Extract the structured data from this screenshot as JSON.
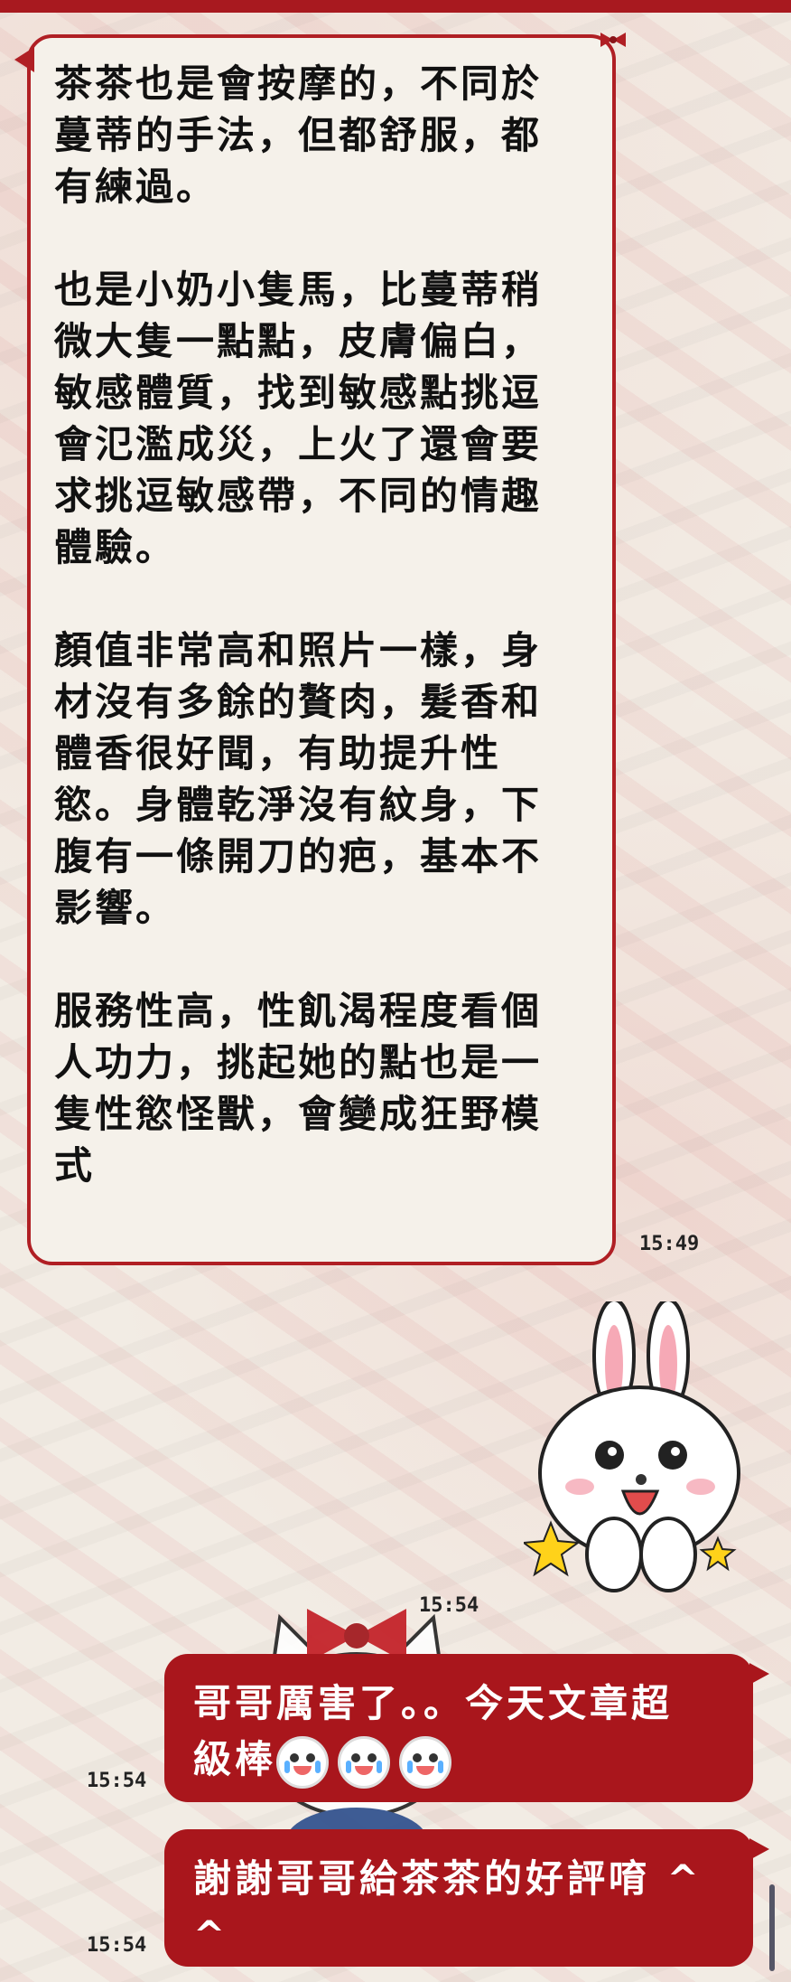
{
  "colors": {
    "accent": "#a9161c",
    "incoming_bubble_bg": "#f5f1ea",
    "incoming_bubble_border": "#b01f24"
  },
  "incoming": {
    "text": "茶茶也是會按摩的，不同於\n蔓蒂的手法，但都舒服，都\n有練過。\n\n也是小奶小隻馬，比蔓蒂稍\n微大隻一點點，皮膚偏白，\n敏感體質，找到敏感點挑逗\n會氾濫成災，上火了還會要\n求挑逗敏感帶，不同的情趣\n體驗。\n\n顏值非常高和照片一樣，身\n材沒有多餘的贅肉，髮香和\n體香很好聞，有助提升性\n慾。身體乾淨沒有紋身，下\n腹有一條開刀的疤，基本不\n影響。\n\n服務性高，性飢渴程度看個\n人功力，挑起她的點也是一\n隻性慾怪獸，會變成狂野模\n式",
    "time": "15:49"
  },
  "sticker": {
    "icon": "bunny-sticker-icon",
    "time": "15:54"
  },
  "outgoing": [
    {
      "text": "哥哥厲害了。。今天文章超\n級棒",
      "emoji_count": 3,
      "emoji_icon": "crying-laughing-face-icon",
      "time": "15:54"
    },
    {
      "text": "謝謝哥哥給茶茶的好評唷 ^\n^",
      "time": "15:54"
    }
  ]
}
